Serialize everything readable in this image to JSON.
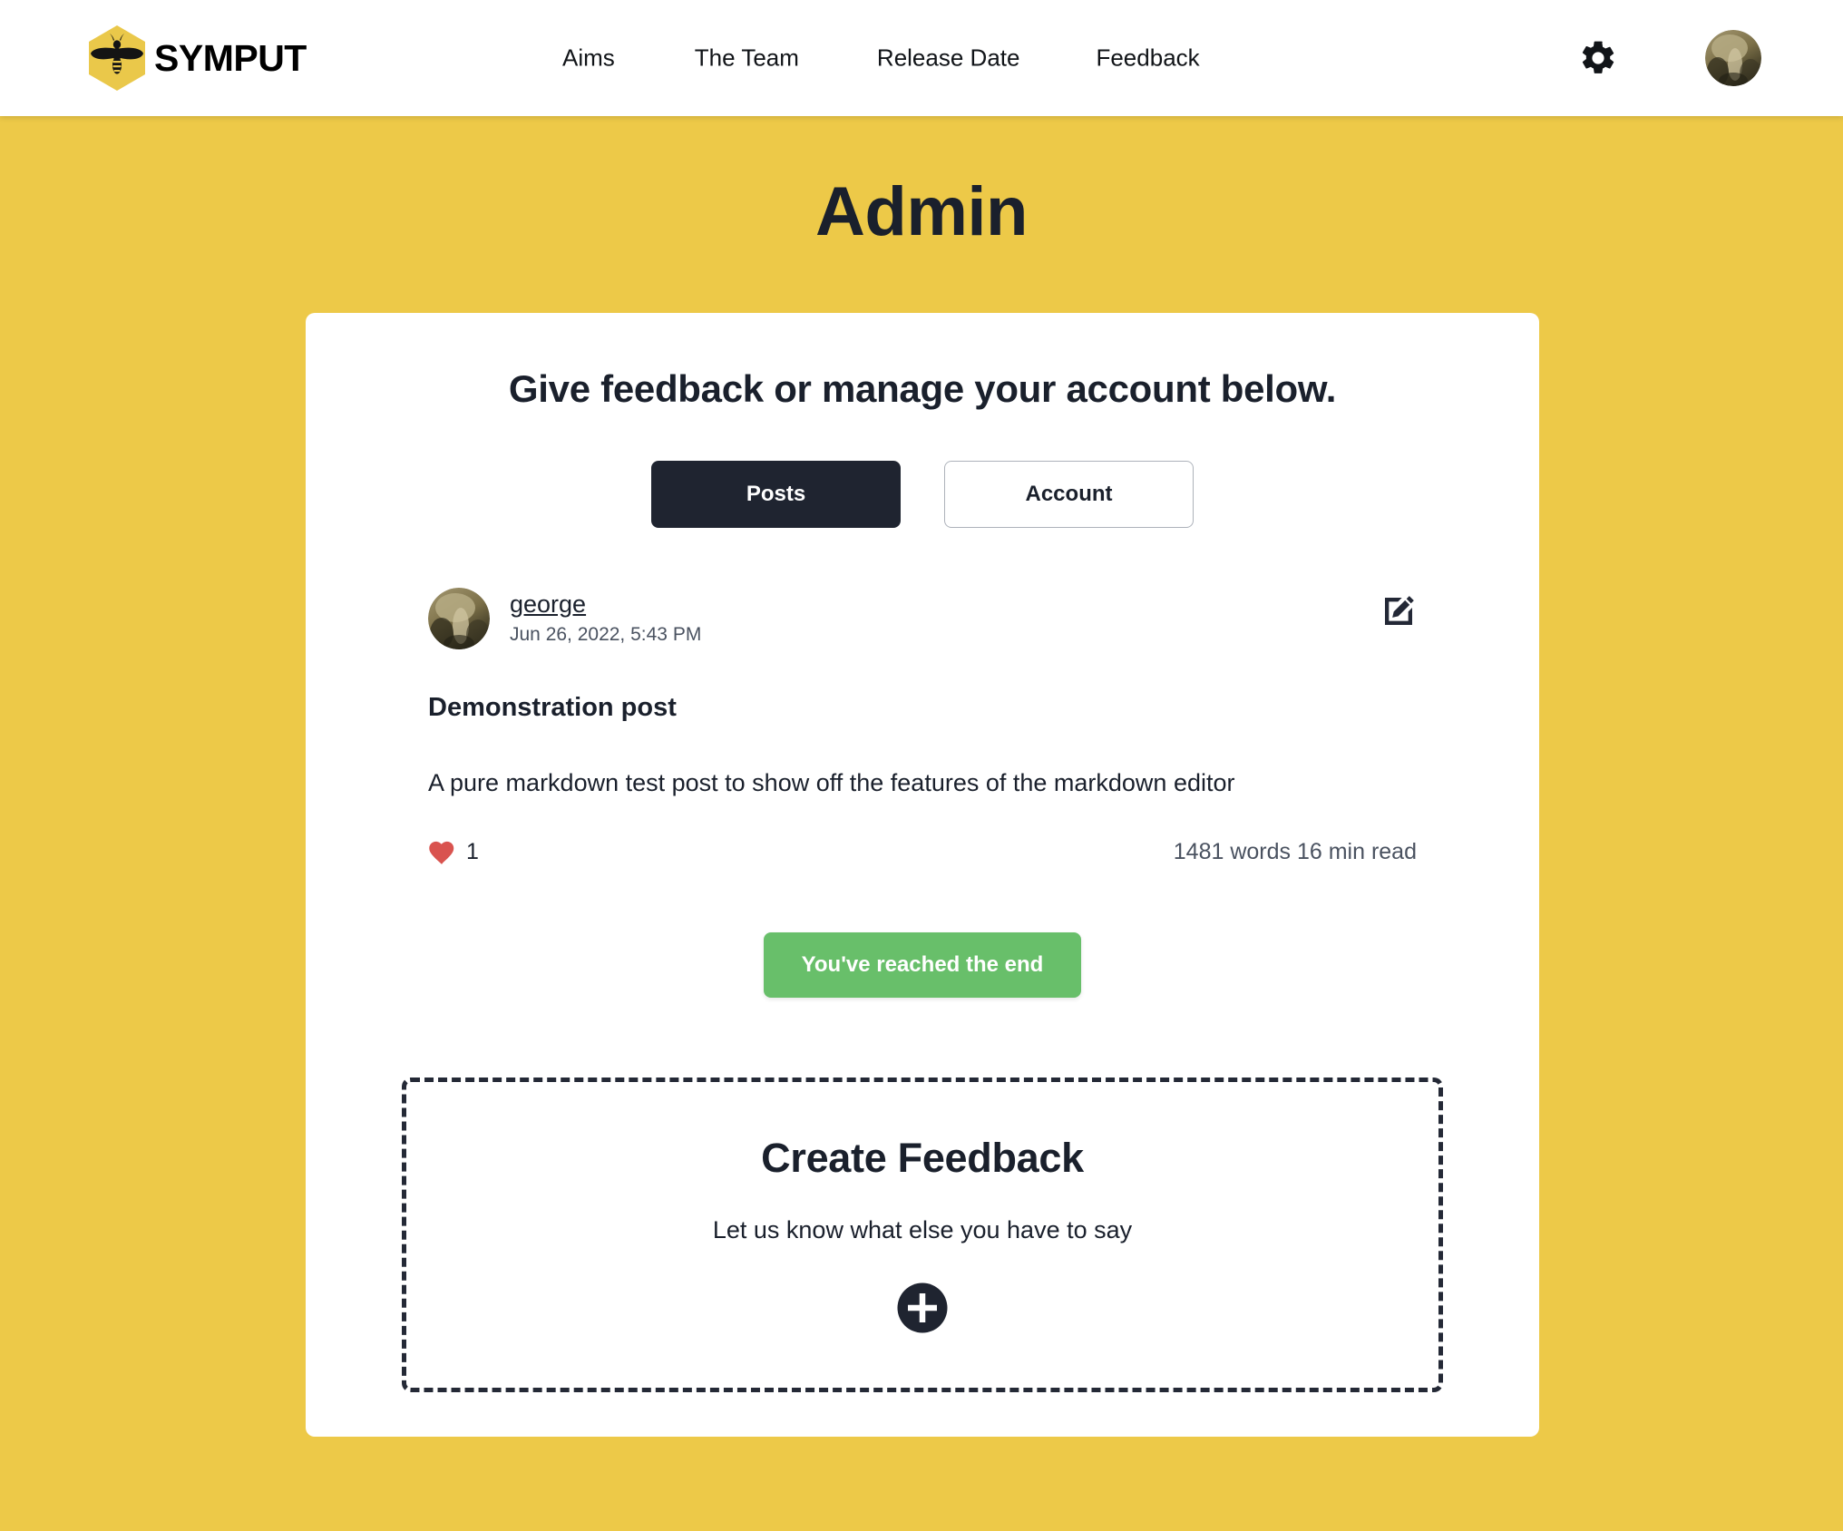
{
  "brand": {
    "name": "SYMPUT",
    "logo_icon": "bee-hexagon-logo",
    "logo_hex_color": "#eac84a"
  },
  "nav": {
    "links": [
      {
        "label": "Aims"
      },
      {
        "label": "The Team"
      },
      {
        "label": "Release Date"
      },
      {
        "label": "Feedback"
      }
    ],
    "settings_icon": "gear-icon",
    "avatar_icon": "user-avatar"
  },
  "page": {
    "title": "Admin",
    "background_color": "#edc948",
    "text_color": "#1a202c"
  },
  "card": {
    "heading": "Give feedback or manage your account below.",
    "tabs": [
      {
        "label": "Posts",
        "active": true
      },
      {
        "label": "Account",
        "active": false
      }
    ]
  },
  "post": {
    "author": "george",
    "date": "Jun 26, 2022, 5:43 PM",
    "title": "Demonstration post",
    "body": "A pure markdown test post to show off the features of the markdown editor",
    "like_icon": "heart-icon",
    "like_count": "1",
    "read_stats": "1481 words 16 min read",
    "edit_icon": "edit-pencil-icon",
    "avatar_icon": "user-avatar"
  },
  "end_badge": {
    "label": "You've reached the end",
    "color": "#68bf6a"
  },
  "create_feedback": {
    "title": "Create Feedback",
    "subtitle": "Let us know what else you have to say",
    "add_icon": "plus-circle-icon"
  }
}
